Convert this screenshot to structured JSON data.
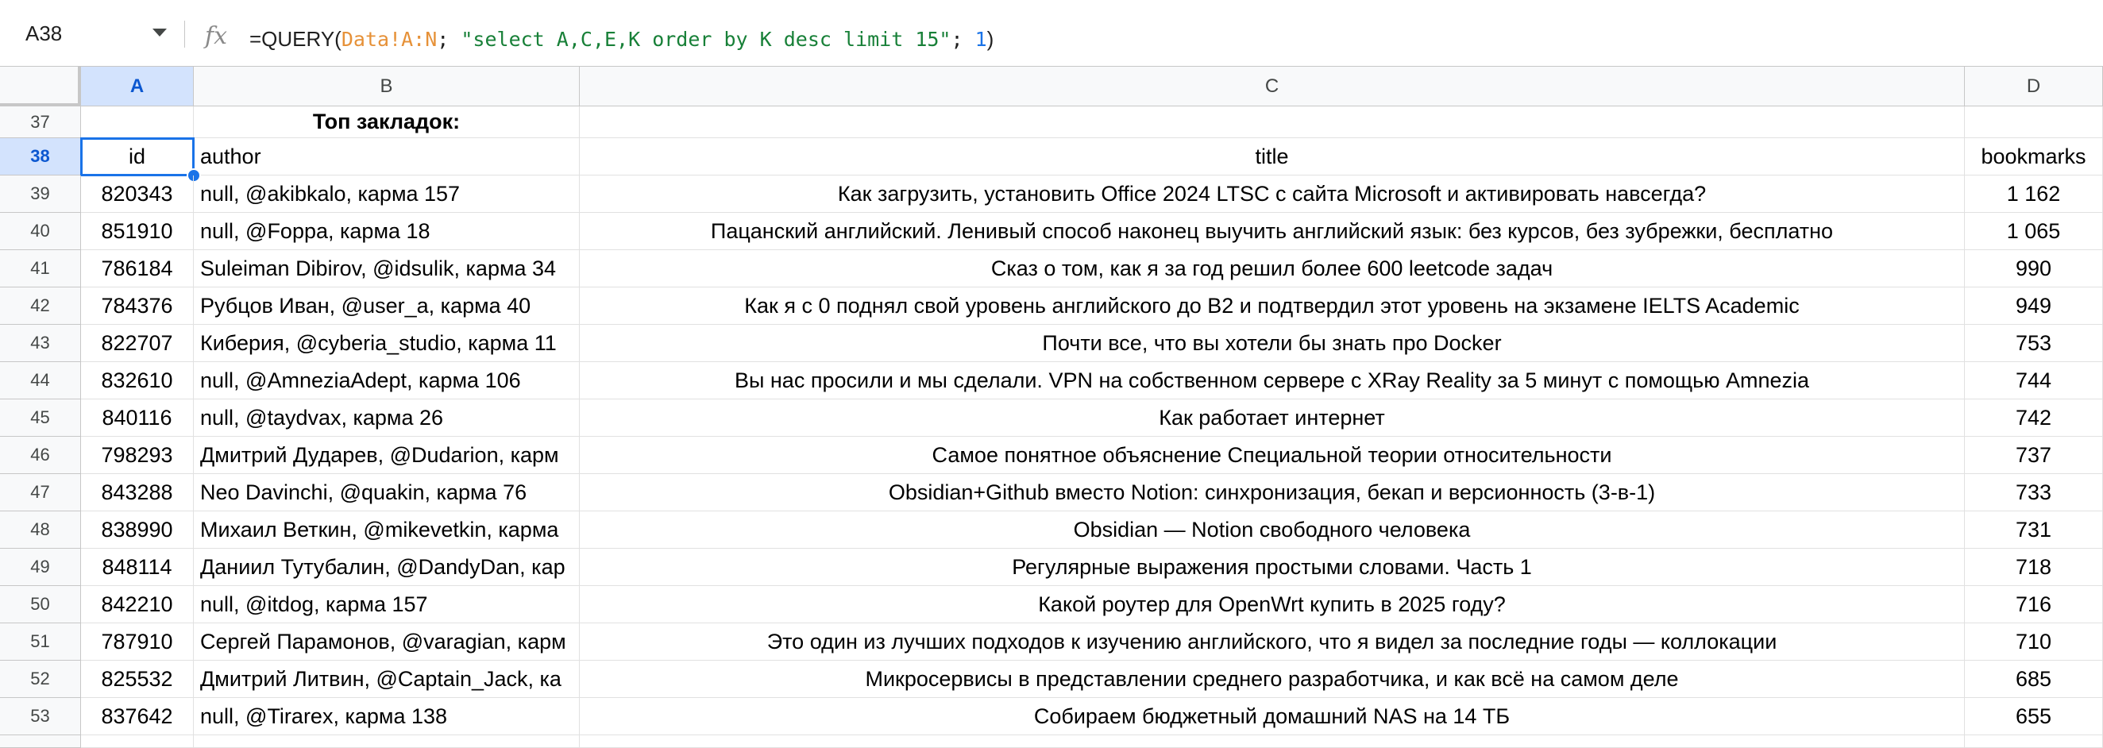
{
  "formula_bar": {
    "cell_ref": "A38",
    "fx_label": "fx",
    "formula_parts": [
      {
        "text": "=QUERY(",
        "kind": "fn"
      },
      {
        "text": "Data!A:N",
        "kind": "ref"
      },
      {
        "text": "; ",
        "kind": "plain"
      },
      {
        "text": "\"select A,C,E,K order by K desc limit 15\"",
        "kind": "str"
      },
      {
        "text": "; ",
        "kind": "plain"
      },
      {
        "text": "1",
        "kind": "num"
      },
      {
        "text": ")",
        "kind": "fn"
      }
    ]
  },
  "columns": [
    "A",
    "B",
    "C",
    "D"
  ],
  "selected_column": "A",
  "selected_row": "38",
  "section_title": "Топ закладок:",
  "header_row": {
    "row": "38",
    "id": "id",
    "author": "author",
    "title": "title",
    "bookmarks": "bookmarks"
  },
  "title_row_number": "37",
  "rows": [
    {
      "row": "39",
      "id": "820343",
      "author": "null, @akibkalo, карма 157",
      "title": "Как загрузить, установить Office 2024 LTSC с сайта Microsoft и активировать навсегда?",
      "bookmarks": "1 162"
    },
    {
      "row": "40",
      "id": "851910",
      "author": "null, @Foppa, карма 18",
      "title": "Пацанский английский. Ленивый способ наконец выучить английский язык: без курсов, без зубрежки, бесплатно",
      "bookmarks": "1 065"
    },
    {
      "row": "41",
      "id": "786184",
      "author": "Suleiman Dibirov, @idsulik, карма 34",
      "title": "Сказ о том, как я за год решил более 600 leetcode задач",
      "bookmarks": "990"
    },
    {
      "row": "42",
      "id": "784376",
      "author": "Рубцов Иван, @user_a, карма 40",
      "title": "Как я с 0 поднял свой уровень английского до B2 и подтвердил этот уровень на экзамене IELTS Academic",
      "bookmarks": "949"
    },
    {
      "row": "43",
      "id": "822707",
      "author": "Киберия, @cyberia_studio, карма 11",
      "title": "Почти все, что вы хотели бы знать про Docker",
      "bookmarks": "753"
    },
    {
      "row": "44",
      "id": "832610",
      "author": "null, @AmneziaAdept, карма 106",
      "title": "Вы нас просили и мы сделали. VPN на собственном сервере с XRay Reality за 5 минут с помощью Amnezia",
      "bookmarks": "744"
    },
    {
      "row": "45",
      "id": "840116",
      "author": "null, @taydvax, карма 26",
      "title": "Как работает интернет",
      "bookmarks": "742"
    },
    {
      "row": "46",
      "id": "798293",
      "author": "Дмитрий Дударев, @Dudarion, карм",
      "title": "Самое понятное объяснение Специальной теории относительности",
      "bookmarks": "737"
    },
    {
      "row": "47",
      "id": "843288",
      "author": "Neo Davinchi, @quakin, карма 76",
      "title": "Obsidian+Github вместо Notion: синхронизация, бекап и версионность (3-в-1)",
      "bookmarks": "733"
    },
    {
      "row": "48",
      "id": "838990",
      "author": "Михаил Веткин, @mikevetkin, карма",
      "title": "Obsidian — Notion свободного человека",
      "bookmarks": "731"
    },
    {
      "row": "49",
      "id": "848114",
      "author": "Даниил Тутубалин, @DandyDan, кар",
      "title": "Регулярные выражения простыми словами. Часть 1",
      "bookmarks": "718"
    },
    {
      "row": "50",
      "id": "842210",
      "author": "null, @itdog, карма 157",
      "title": "Какой роутер для OpenWrt купить в 2025 году?",
      "bookmarks": "716"
    },
    {
      "row": "51",
      "id": "787910",
      "author": "Сергей Парамонов, @varagian, карм",
      "title": "Это один из лучших подходов к изучению английского, что я видел за последние годы — коллокации",
      "bookmarks": "710"
    },
    {
      "row": "52",
      "id": "825532",
      "author": "Дмитрий Литвин, @Captain_Jack, ка",
      "title": "Микросервисы в представлении среднего разработчика, и как всё на самом деле",
      "bookmarks": "685"
    },
    {
      "row": "53",
      "id": "837642",
      "author": "null, @Tirarex, карма 138",
      "title": "Собираем бюджетный домашний NAS на 14 ТБ",
      "bookmarks": "655"
    }
  ],
  "colors": {
    "selection": "#1a73e8",
    "header_bg": "#f8f9fa",
    "selected_header_bg": "#d3e3fd",
    "ref_color": "#e69138",
    "string_color": "#188038",
    "number_color": "#1a73e8"
  }
}
